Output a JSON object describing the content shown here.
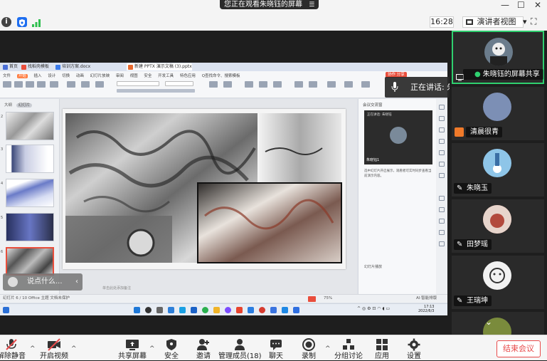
{
  "banner": {
    "text": "您正在观看朱晓钰的屏幕",
    "menu_icon": "menu-icon"
  },
  "window_controls": {
    "minimize": "—",
    "maximize": "☐",
    "close": "✕"
  },
  "top": {
    "time": "16:28",
    "view_label": "演讲者视图",
    "view_caret": "▾",
    "fullscreen": "⛶"
  },
  "speaking": {
    "text": "正在讲话: 朱晓钰;"
  },
  "shared_app": {
    "tabs": [
      {
        "label": "首页",
        "color": "#4a6fd8"
      },
      {
        "label": "找稻壳模板",
        "color": "#e94e3c"
      },
      {
        "label": "培训方案.docx",
        "color": "#3b7bea"
      },
      {
        "label": "新建 PPTX 演示文稿 (3).pptx",
        "color": "#e86a2f"
      }
    ],
    "menu": [
      "文件",
      "开始",
      "插入",
      "设计",
      "切换",
      "动画",
      "幻灯片放映",
      "审阅",
      "视图",
      "安全",
      "开发工具",
      "特色应用",
      "Q查找命令、搜索模板"
    ],
    "menu_selected": "开始",
    "share_button": "协作 分享",
    "left_tabs": [
      "大纲",
      "幻灯片"
    ],
    "slide_numbers": [
      "2",
      "3",
      "4",
      "5",
      "6"
    ],
    "right_title": "会议交流窗",
    "right_video_label": "正在讲话: 朱晓钰",
    "right_video_name": "朱晓钰1",
    "right_text": "选中幻灯片开启展示，观看者可实时同步查看当前演示内容。",
    "right_bottom": "幻灯片播放",
    "notes": "单击此处添加备注",
    "status_left": "幻灯片 6 / 10   Office 主题   文档未保护",
    "zoom": "75%",
    "ai_label": "AI·智能排版",
    "tray_time": "17:13",
    "tray_date": "2022/6/3"
  },
  "say_box": {
    "text": "说点什么...",
    "close": "‹"
  },
  "participants": [
    {
      "name": "朱晓钰的屏幕共享",
      "active": true,
      "avatar_color": "#6b7c8c"
    },
    {
      "name": "清晨很青",
      "host": true,
      "avatar_color": "#7c8fb5"
    },
    {
      "name": "朱晓玉",
      "avatar_color": "#8ec5e8"
    },
    {
      "name": "田梦瑶",
      "avatar_color": "#c96a5e"
    },
    {
      "name": "王瑞坤",
      "avatar_color": "#f2f2f2"
    },
    {
      "name": "",
      "avatar_color": "#7a8b3c"
    }
  ],
  "toolbar": [
    {
      "label": "解除静音",
      "icon": "mic-muted-icon",
      "caret": true
    },
    {
      "label": "开启视频",
      "icon": "video-off-icon",
      "caret": true
    },
    {
      "label": "共享屏幕",
      "icon": "share-screen-icon",
      "caret": true
    },
    {
      "label": "安全",
      "icon": "shield-icon"
    },
    {
      "label": "邀请",
      "icon": "invite-icon"
    },
    {
      "label": "管理成员(18)",
      "icon": "members-icon"
    },
    {
      "label": "聊天",
      "icon": "chat-icon"
    },
    {
      "label": "录制",
      "icon": "record-icon",
      "caret": true
    },
    {
      "label": "分组讨论",
      "icon": "breakout-icon"
    },
    {
      "label": "应用",
      "icon": "apps-icon"
    },
    {
      "label": "设置",
      "icon": "settings-icon"
    }
  ],
  "end_button": "结束会议"
}
